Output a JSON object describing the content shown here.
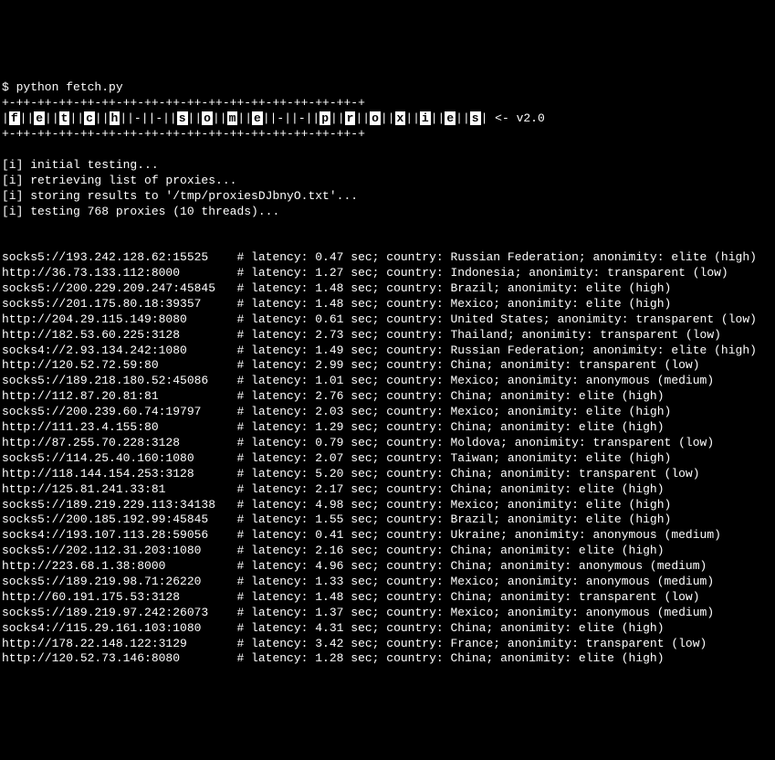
{
  "prompt": "$ python fetch.py",
  "banner_border": "+-++-++-++-++-++-++-++-++-++-++-++-++-++-++-++-++-+",
  "banner_letters": [
    "f",
    "e",
    "t",
    "c",
    "h",
    " ",
    " ",
    "s",
    "o",
    "m",
    "e",
    " ",
    " ",
    "p",
    "r",
    "o",
    "x",
    "i",
    "e",
    "s"
  ],
  "banner_version": " <- v2.0",
  "info": [
    "[i] initial testing...",
    "[i] retrieving list of proxies...",
    "[i] storing results to '/tmp/proxiesDJbnyO.txt'...",
    "[i] testing 768 proxies (10 threads)..."
  ],
  "proxies": [
    {
      "url": "socks5://193.242.128.62:15525",
      "latency": "0.47",
      "country": "Russian Federation",
      "anonimity": "elite (high)"
    },
    {
      "url": "http://36.73.133.112:8000",
      "latency": "1.27",
      "country": "Indonesia",
      "anonimity": "transparent (low)"
    },
    {
      "url": "socks5://200.229.209.247:45845",
      "latency": "1.48",
      "country": "Brazil",
      "anonimity": "elite (high)"
    },
    {
      "url": "socks5://201.175.80.18:39357",
      "latency": "1.48",
      "country": "Mexico",
      "anonimity": "elite (high)"
    },
    {
      "url": "http://204.29.115.149:8080",
      "latency": "0.61",
      "country": "United States",
      "anonimity": "transparent (low)"
    },
    {
      "url": "http://182.53.60.225:3128",
      "latency": "2.73",
      "country": "Thailand",
      "anonimity": "transparent (low)"
    },
    {
      "url": "socks4://2.93.134.242:1080",
      "latency": "1.49",
      "country": "Russian Federation",
      "anonimity": "elite (high)"
    },
    {
      "url": "http://120.52.72.59:80",
      "latency": "2.99",
      "country": "China",
      "anonimity": "transparent (low)"
    },
    {
      "url": "socks5://189.218.180.52:45086",
      "latency": "1.01",
      "country": "Mexico",
      "anonimity": "anonymous (medium)"
    },
    {
      "url": "http://112.87.20.81:81",
      "latency": "2.76",
      "country": "China",
      "anonimity": "elite (high)"
    },
    {
      "url": "socks5://200.239.60.74:19797",
      "latency": "2.03",
      "country": "Mexico",
      "anonimity": "elite (high)"
    },
    {
      "url": "http://111.23.4.155:80",
      "latency": "1.29",
      "country": "China",
      "anonimity": "elite (high)"
    },
    {
      "url": "http://87.255.70.228:3128",
      "latency": "0.79",
      "country": "Moldova",
      "anonimity": "transparent (low)"
    },
    {
      "url": "socks5://114.25.40.160:1080",
      "latency": "2.07",
      "country": "Taiwan",
      "anonimity": "elite (high)"
    },
    {
      "url": "http://118.144.154.253:3128",
      "latency": "5.20",
      "country": "China",
      "anonimity": "transparent (low)"
    },
    {
      "url": "http://125.81.241.33:81",
      "latency": "2.17",
      "country": "China",
      "anonimity": "elite (high)"
    },
    {
      "url": "socks5://189.219.229.113:34138",
      "latency": "4.98",
      "country": "Mexico",
      "anonimity": "elite (high)"
    },
    {
      "url": "socks5://200.185.192.99:45845",
      "latency": "1.55",
      "country": "Brazil",
      "anonimity": "elite (high)"
    },
    {
      "url": "socks4://193.107.113.28:59056",
      "latency": "0.41",
      "country": "Ukraine",
      "anonimity": "anonymous (medium)"
    },
    {
      "url": "socks5://202.112.31.203:1080",
      "latency": "2.16",
      "country": "China",
      "anonimity": "elite (high)"
    },
    {
      "url": "http://223.68.1.38:8000",
      "latency": "4.96",
      "country": "China",
      "anonimity": "anonymous (medium)"
    },
    {
      "url": "socks5://189.219.98.71:26220",
      "latency": "1.33",
      "country": "Mexico",
      "anonimity": "anonymous (medium)"
    },
    {
      "url": "http://60.191.175.53:3128",
      "latency": "1.48",
      "country": "China",
      "anonimity": "transparent (low)"
    },
    {
      "url": "socks5://189.219.97.242:26073",
      "latency": "1.37",
      "country": "Mexico",
      "anonimity": "anonymous (medium)"
    },
    {
      "url": "socks4://115.29.161.103:1080",
      "latency": "4.31",
      "country": "China",
      "anonimity": "elite (high)"
    },
    {
      "url": "http://178.22.148.122:3129",
      "latency": "3.42",
      "country": "France",
      "anonimity": "transparent (low)"
    },
    {
      "url": "http://120.52.73.146:8080",
      "latency": "1.28",
      "country": "China",
      "anonimity": "elite (high)"
    }
  ]
}
